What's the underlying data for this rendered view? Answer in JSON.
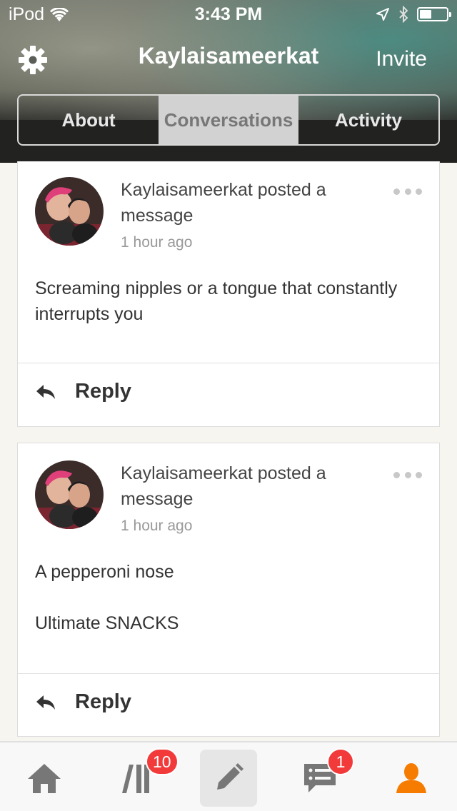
{
  "status_bar": {
    "carrier": "iPod",
    "time": "3:43 PM"
  },
  "header": {
    "title": "Kaylaisameerkat",
    "invite_label": "Invite"
  },
  "tabs": [
    {
      "label": "About",
      "active": false
    },
    {
      "label": "Conversations",
      "active": true
    },
    {
      "label": "Activity",
      "active": false
    }
  ],
  "posts": [
    {
      "author_line": "Kaylaisameerkat posted a message",
      "time": "1 hour ago",
      "body": [
        "Screaming nipples or a tongue that constantly interrupts you"
      ],
      "reply_label": "Reply"
    },
    {
      "author_line": "Kaylaisameerkat posted a message",
      "time": "1 hour ago",
      "body": [
        "A pepperoni nose",
        "Ultimate SNACKS"
      ],
      "reply_label": "Reply"
    }
  ],
  "bottom_nav": {
    "library_badge": "10",
    "messages_badge": "1",
    "accent_color": "#f57c00",
    "icons": [
      "home-icon",
      "library-icon",
      "pencil-icon",
      "messages-icon",
      "profile-icon"
    ]
  }
}
